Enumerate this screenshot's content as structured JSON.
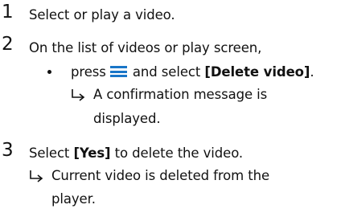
{
  "steps": [
    {
      "number": "1",
      "text": "Select or play a video."
    },
    {
      "number": "2",
      "text": "On the list of videos or play screen,",
      "bullet": {
        "pre": "press",
        "icon": "menu-icon",
        "post": "and select",
        "keyword": "[Delete video]",
        "end": "."
      },
      "result_lines": [
        "A confirmation message is",
        "displayed."
      ]
    },
    {
      "number": "3",
      "pre": "Select",
      "keyword": "[Yes]",
      "post": "to delete the video.",
      "result_lines": [
        "Current video is deleted from the",
        "player."
      ]
    }
  ],
  "colors": {
    "text": "#111111",
    "menu_icon": "#1976c8"
  }
}
